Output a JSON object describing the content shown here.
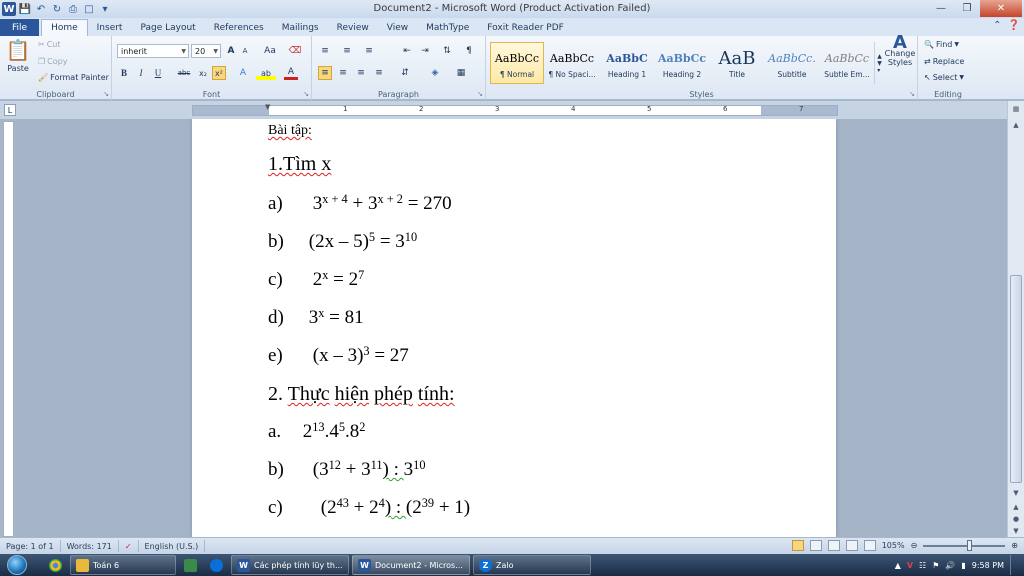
{
  "window": {
    "title": "Document2 - Microsoft Word (Product Activation Failed)",
    "app_logo": "W"
  },
  "qat": {
    "icons": [
      "word-logo",
      "save-icon",
      "undo-icon",
      "redo-icon",
      "print-preview-icon",
      "new-document-icon",
      "customize-arrow-icon"
    ]
  },
  "tabs": [
    "File",
    "Home",
    "Insert",
    "Page Layout",
    "References",
    "Mailings",
    "Review",
    "View",
    "MathType",
    "Foxit Reader PDF"
  ],
  "active_tab": "Home",
  "ribbon": {
    "clipboard": {
      "label": "Clipboard",
      "paste": "Paste",
      "cut": "Cut",
      "copy": "Copy",
      "format_painter": "Format Painter"
    },
    "font": {
      "label": "Font",
      "font_name": "inherit",
      "font_size": "20",
      "bold": "B",
      "italic": "I",
      "underline": "U",
      "strike": "abc",
      "subscript": "x₂",
      "superscript": "x²",
      "grow": "A",
      "shrink": "A",
      "change_case": "Aa",
      "text_effects": "A",
      "highlight": "ab",
      "font_color": "A"
    },
    "paragraph": {
      "label": "Paragraph",
      "pilcrow": "¶"
    },
    "styles": {
      "label": "Styles",
      "items": [
        {
          "sample": "AaBbCc",
          "name": "¶ Normal"
        },
        {
          "sample": "AaBbCc",
          "name": "¶ No Spaci..."
        },
        {
          "sample": "AaBbC",
          "name": "Heading 1"
        },
        {
          "sample": "AaBbCc",
          "name": "Heading 2"
        },
        {
          "sample": "AaB",
          "name": "Title"
        },
        {
          "sample": "AaBbCc.",
          "name": "Subtitle"
        },
        {
          "sample": "AaBbCc",
          "name": "Subtle Em..."
        }
      ],
      "change_styles": "Change Styles"
    },
    "editing": {
      "label": "Editing",
      "find": "Find",
      "replace": "Replace",
      "select": "Select"
    }
  },
  "ruler_numbers": [
    "1",
    "1",
    "2",
    "3",
    "4",
    "5",
    "6",
    "7"
  ],
  "document": {
    "heading": "Bài tập:",
    "section1": "1.Tìm x",
    "items1": [
      {
        "label": "a)",
        "base1": "3",
        "exp1": "x + 4",
        "op": " + ",
        "base2": "3",
        "exp2": "x + 2",
        "rhs": " = 270"
      },
      {
        "label": "b)",
        "base1": "(2x – 5)",
        "exp1": "5",
        "op": " = ",
        "base2": "3",
        "exp2": "10",
        "rhs": ""
      },
      {
        "label": "c)",
        "base1": "2",
        "exp1": "x",
        "op": " = ",
        "base2": "2",
        "exp2": "7",
        "rhs": ""
      },
      {
        "label": "d)",
        "base1": "3",
        "exp1": "x",
        "op": " = 81",
        "base2": "",
        "exp2": "",
        "rhs": ""
      },
      {
        "label": "e)",
        "base1": "(x – 3)",
        "exp1": "3",
        "op": " = 27",
        "base2": "",
        "exp2": "",
        "rhs": ""
      }
    ],
    "section2_num": "2.",
    "section2_words": [
      "Thực",
      "hiện",
      "phép",
      "tính:"
    ],
    "items2": [
      {
        "label": "a.",
        "parts": [
          {
            "b": "2",
            "e": "13"
          },
          {
            "b": ".4",
            "e": "5"
          },
          {
            "b": ".8",
            "e": "2"
          }
        ]
      },
      {
        "label": "b)",
        "pre": "(",
        "parts": [
          {
            "b": "3",
            "e": "12"
          },
          {
            "b": " + 3",
            "e": "11"
          }
        ],
        "close": ")",
        "div": " : ",
        "parts_after": [
          {
            "b": "3",
            "e": "10"
          }
        ]
      },
      {
        "label": "c)",
        "pre": "(",
        "parts": [
          {
            "b": "2",
            "e": "43"
          },
          {
            "b": " + 2",
            "e": "4"
          }
        ],
        "close": ")",
        "div": " : ",
        "parts_after": [
          {
            "b": "(2",
            "e": "39"
          },
          {
            "b": " + 1)",
            "e": ""
          }
        ]
      }
    ]
  },
  "statusbar": {
    "page": "Page: 1 of 1",
    "words": "Words: 171",
    "language": "English (U.S.)",
    "zoom": "105%",
    "zoom_value_percent": 105
  },
  "taskbar": {
    "items": [
      {
        "label": "",
        "icon": "chrome-icon"
      },
      {
        "label": "Toán 6",
        "icon": "folder-icon"
      },
      {
        "label": "",
        "icon": "app-icon"
      },
      {
        "label": "",
        "icon": "zalo-small-icon"
      },
      {
        "label": "Các phép tính lũy th...",
        "icon": "word-doc-icon"
      },
      {
        "label": "Document2 - Micros...",
        "icon": "word-doc-icon"
      },
      {
        "label": "Zalo",
        "icon": "zalo-icon"
      }
    ],
    "clock": "9:58 PM"
  }
}
